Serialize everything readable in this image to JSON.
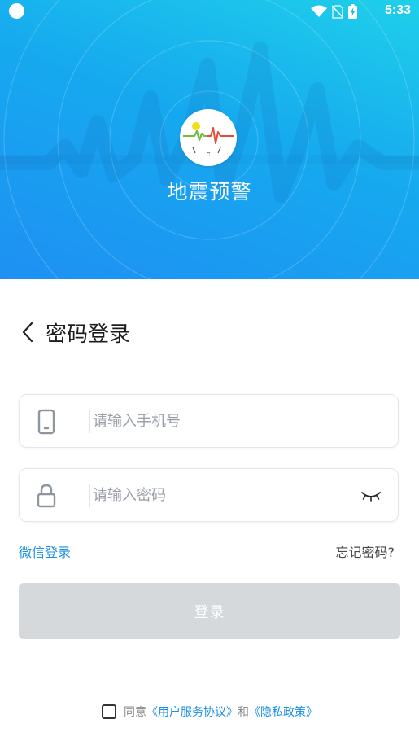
{
  "status_bar": {
    "time": "5:33",
    "icons": [
      "wifi-icon",
      "no-sim-icon",
      "battery-charging-icon"
    ]
  },
  "header": {
    "app_name": "地震预警",
    "logo_letter": "c"
  },
  "login": {
    "title": "密码登录",
    "phone_placeholder": "请输入手机号",
    "password_placeholder": "请输入密码",
    "wechat_login": "微信登录",
    "forgot_password": "忘记密码?",
    "submit_label": "登录"
  },
  "agreement": {
    "prefix": "同意",
    "user_agreement": "《用户服务协议》",
    "and": "和",
    "privacy_policy": "《隐私政策》"
  },
  "colors": {
    "header_gradient_start": "#1fd0ea",
    "header_gradient_end": "#1e90f3",
    "link": "#1a8fe5",
    "button_disabled": "#d6d9dc"
  }
}
